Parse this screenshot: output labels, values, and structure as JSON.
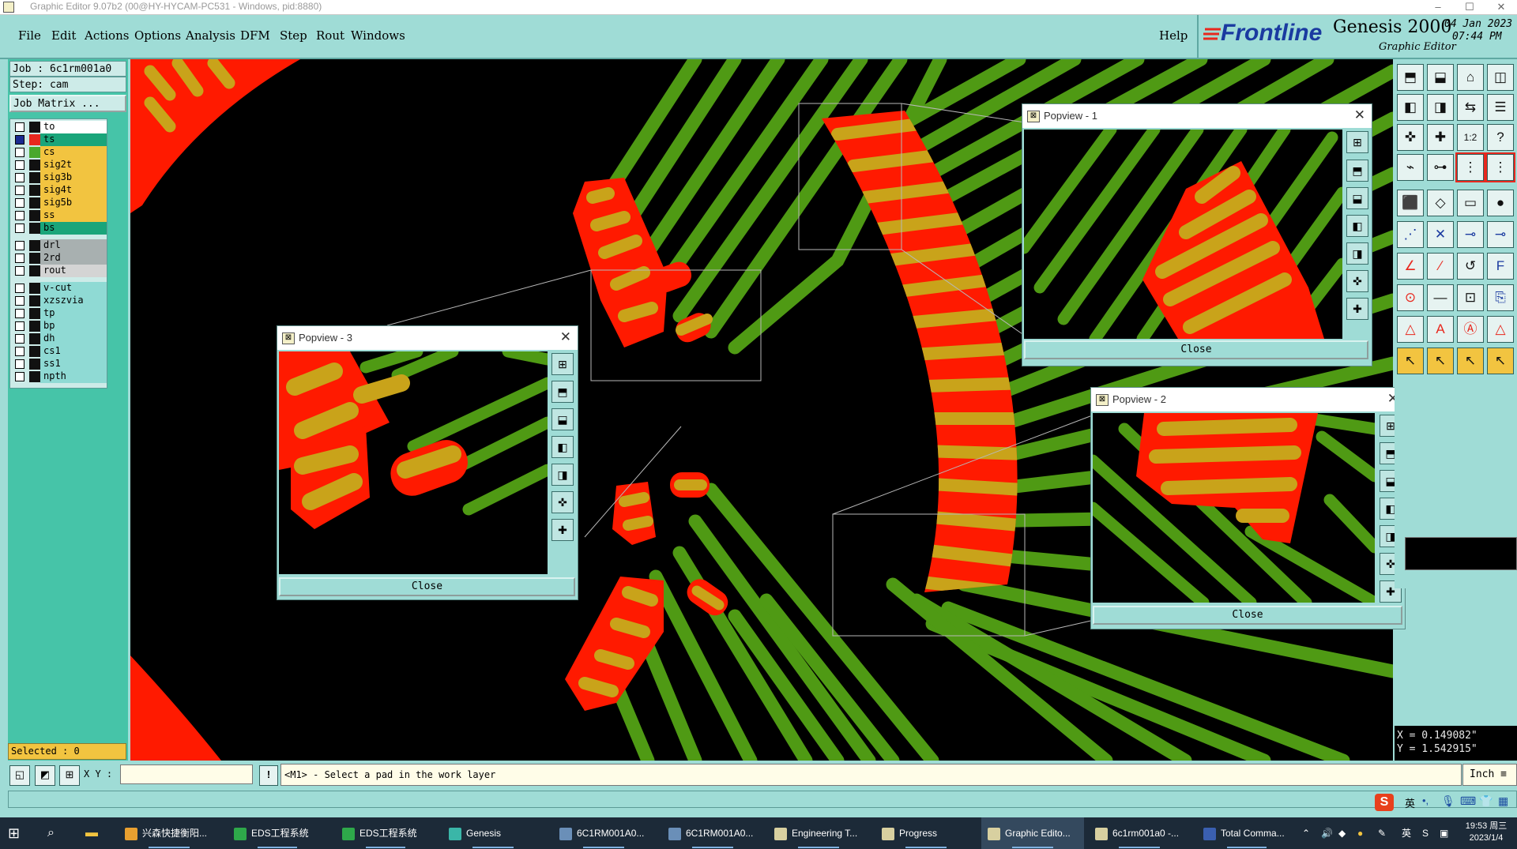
{
  "window": {
    "title": "Graphic Editor 9.07b2 (00@HY-HYCAM-PC531 - Windows, pid:8880)",
    "controls": [
      "–",
      "☐",
      "✕"
    ]
  },
  "menu": {
    "items": [
      {
        "label": "File"
      },
      {
        "label": "Edit"
      },
      {
        "label": "Actions"
      },
      {
        "label": "Options"
      },
      {
        "label": "Analysis"
      },
      {
        "label": "DFM"
      },
      {
        "label": "Step"
      },
      {
        "label": "Rout"
      },
      {
        "label": "Windows"
      }
    ],
    "help": "Help"
  },
  "brand": {
    "logo": "Frontline",
    "product": "Genesis 2000",
    "subtitle": "Graphic Editor",
    "date": "04 Jan 2023",
    "time": "07:44 PM"
  },
  "job": {
    "job_label": "Job : 6c1rm001a0",
    "step_label": "Step: cam",
    "matrix_button": "Job Matrix ..."
  },
  "layers": [
    {
      "name": "to",
      "bg": "#ffffff",
      "swatch": "#111111",
      "checked": false
    },
    {
      "name": "ts",
      "bg": "#1aa57a",
      "swatch": "#e8281e",
      "checked": true
    },
    {
      "name": "cs",
      "bg": "#f2c440",
      "swatch": "#49a82c",
      "checked": false
    },
    {
      "name": "sig2t",
      "bg": "#f2c440",
      "swatch": "#111111",
      "checked": false
    },
    {
      "name": "sig3b",
      "bg": "#f2c440",
      "swatch": "#111111",
      "checked": false
    },
    {
      "name": "sig4t",
      "bg": "#f2c440",
      "swatch": "#111111",
      "checked": false
    },
    {
      "name": "sig5b",
      "bg": "#f2c440",
      "swatch": "#111111",
      "checked": false
    },
    {
      "name": "ss",
      "bg": "#f2c440",
      "swatch": "#111111",
      "checked": false
    },
    {
      "name": "bs",
      "bg": "#1aa57a",
      "swatch": "#111111",
      "checked": false
    },
    {
      "name": "drl",
      "bg": "#a8b0b0",
      "swatch": "#111111",
      "checked": false
    },
    {
      "name": "2rd",
      "bg": "#a8b0b0",
      "swatch": "#111111",
      "checked": false
    },
    {
      "name": "rout",
      "bg": "#d4d4d4",
      "swatch": "#111111",
      "checked": false
    },
    {
      "name": "v-cut",
      "bg": "#8fdad4",
      "swatch": "#111111",
      "checked": false
    },
    {
      "name": "xzszvia",
      "bg": "#8fdad4",
      "swatch": "#111111",
      "checked": false
    },
    {
      "name": "tp",
      "bg": "#8fdad4",
      "swatch": "#111111",
      "checked": false
    },
    {
      "name": "bp",
      "bg": "#8fdad4",
      "swatch": "#111111",
      "checked": false
    },
    {
      "name": "dh",
      "bg": "#8fdad4",
      "swatch": "#111111",
      "checked": false
    },
    {
      "name": "cs1",
      "bg": "#8fdad4",
      "swatch": "#111111",
      "checked": false
    },
    {
      "name": "ss1",
      "bg": "#8fdad4",
      "swatch": "#111111",
      "checked": false
    },
    {
      "name": "npth",
      "bg": "#8fdad4",
      "swatch": "#111111",
      "checked": false
    }
  ],
  "selected": "Selected : 0",
  "popups": {
    "p1": {
      "title": "Popview - 1",
      "close": "Close"
    },
    "p2": {
      "title": "Popview - 2",
      "close": "Close"
    },
    "p3": {
      "title": "Popview - 3",
      "close": "Close"
    }
  },
  "coords": {
    "x": "X = 0.149082\"",
    "y": "Y = 1.542915\""
  },
  "status": {
    "xy_label": "X Y :",
    "xy_value": "",
    "message": "<M1> - Select a pad in the work layer",
    "unit": "Inch",
    "bang": "!"
  },
  "ime": {
    "lang": "英"
  },
  "taskbar": {
    "items": [
      {
        "label": "兴森快捷衡阳...",
        "icon": "#e8a030"
      },
      {
        "label": "EDS工程系统",
        "icon": "#2ea84a"
      },
      {
        "label": "EDS工程系统",
        "icon": "#2ea84a"
      },
      {
        "label": "Genesis",
        "icon": "#3ab6a8"
      },
      {
        "label": "6C1RM001A0...",
        "icon": "#6a8fb8"
      },
      {
        "label": "6C1RM001A0...",
        "icon": "#6a8fb8"
      },
      {
        "label": "Engineering T...",
        "icon": "#d8d0a0"
      },
      {
        "label": "Progress",
        "icon": "#d8d0a0"
      },
      {
        "label": "Graphic Edito...",
        "icon": "#d8d0a0"
      },
      {
        "label": "6c1rm001a0 -...",
        "icon": "#d8d0a0"
      },
      {
        "label": "Total Comma...",
        "icon": "#3a5fb0"
      }
    ],
    "tray_lang": "英",
    "time": "19:53 周三",
    "date": "2023/1/4"
  },
  "colors": {
    "copper": "#4f9a14",
    "pad": "#ff1a00",
    "mask_overlap": "#c9a31a",
    "panel": "#9fdcd6"
  }
}
